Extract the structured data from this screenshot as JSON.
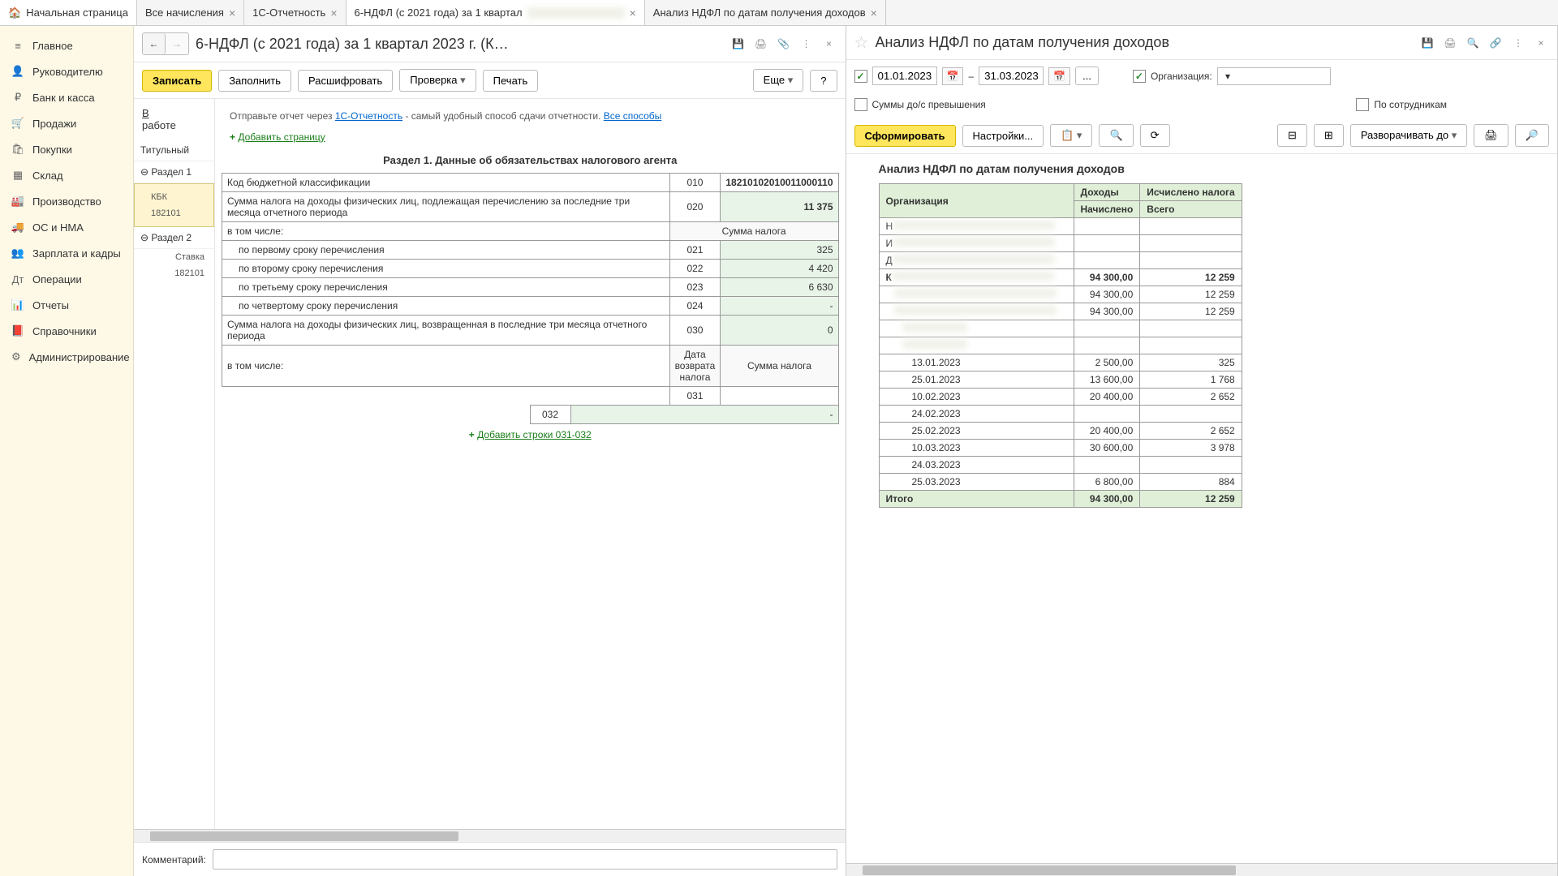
{
  "tabs": {
    "home": "Начальная страница",
    "t1": "Все начисления",
    "t2": "1С-Отчетность",
    "t3": "6-НДФЛ (с 2021 года) за 1 квартал",
    "t4": "Анализ НДФЛ по датам получения доходов"
  },
  "sidebar": [
    {
      "ico": "≡",
      "label": "Главное"
    },
    {
      "ico": "👤",
      "label": "Руководителю"
    },
    {
      "ico": "₽",
      "label": "Банк и касса"
    },
    {
      "ico": "🛒",
      "label": "Продажи"
    },
    {
      "ico": "🛍",
      "label": "Покупки"
    },
    {
      "ico": "▦",
      "label": "Склад"
    },
    {
      "ico": "🏭",
      "label": "Производство"
    },
    {
      "ico": "🚚",
      "label": "ОС и НМА"
    },
    {
      "ico": "👥",
      "label": "Зарплата и кадры"
    },
    {
      "ico": "Дт",
      "label": "Операции"
    },
    {
      "ico": "📊",
      "label": "Отчеты"
    },
    {
      "ico": "📕",
      "label": "Справочники"
    },
    {
      "ico": "⚙",
      "label": "Администрирование"
    }
  ],
  "left_panel": {
    "title": "6-НДФЛ (с 2021 года) за 1 квартал 2023 г. (К…",
    "btn_write": "Записать",
    "btn_fill": "Заполнить",
    "btn_decrypt": "Расшифровать",
    "btn_check": "Проверка",
    "btn_print": "Печать",
    "btn_more": "Еще",
    "status_line1": "В",
    "status_line2": "работе",
    "info_text1": "Отправьте отчет через ",
    "info_link1": "1С-Отчетность",
    "info_text2": " - самый удобный способ сдачи отчетности. ",
    "info_link2": "Все способы",
    "sections": {
      "title_tab": "Титульный",
      "sec1": "Раздел 1",
      "sec1_sub1": "КБК",
      "sec1_sub2": "182101",
      "sec2": "Раздел 2",
      "sec2_sub1": "Ставка",
      "sec2_sub2": "182101"
    },
    "add_page": "Добавить страницу",
    "section_header": "Раздел 1. Данные об обязательствах налогового агента",
    "rows": {
      "r1_label": "Код бюджетной классификации",
      "r1_code": "010",
      "r1_val": "18210102010011000110",
      "r2_label": "Сумма налога на доходы физических лиц, подлежащая перечислению за последние три месяца отчетного периода",
      "r2_code": "020",
      "r2_val": "11 375",
      "incl": "в том числе:",
      "sum_hdr": "Сумма налога",
      "r3_label": "по первому сроку перечисления",
      "r3_code": "021",
      "r3_val": "325",
      "r4_label": "по второму сроку перечисления",
      "r4_code": "022",
      "r4_val": "4 420",
      "r5_label": "по третьему сроку перечисления",
      "r5_code": "023",
      "r5_val": "6 630",
      "r6_label": "по четвертому сроку перечисления",
      "r6_code": "024",
      "r6_val": "-",
      "r7_label": "Сумма налога на доходы физических лиц, возвращенная в последние три месяца отчетного периода",
      "r7_code": "030",
      "r7_val": "0",
      "date_hdr": "Дата возврата налога",
      "r8_code1": "031",
      "r8_code2": "032",
      "r8_val": "-",
      "add_rows": "Добавить строки 031-032"
    },
    "comment_label": "Комментарий:"
  },
  "right_panel": {
    "title": "Анализ НДФЛ по датам получения доходов",
    "date_from": "01.01.2023",
    "date_to": "31.03.2023",
    "org_label": "Организация:",
    "chk_sums": "Суммы до/с превышения",
    "chk_emp": "По сотрудникам",
    "btn_form": "Сформировать",
    "btn_settings": "Настройки...",
    "btn_expand": "Разворачивать до",
    "report_title": "Анализ НДФЛ по датам получения доходов",
    "hdr_org": "Организация",
    "hdr_income": "Доходы",
    "hdr_tax": "Исчислено налога",
    "hdr_accrued": "Начислено",
    "hdr_total": "Всего",
    "row_prefix_n": "Н",
    "row_prefix_i": "И",
    "row_prefix_d": "Д",
    "row_prefix_k": "К",
    "total_label": "Итого",
    "data_rows": [
      {
        "d": "",
        "v1": "94 300,00",
        "v2": "12 259",
        "bold": true
      },
      {
        "d": "",
        "v1": "94 300,00",
        "v2": "12 259"
      },
      {
        "d": "",
        "v1": "94 300,00",
        "v2": "12 259"
      },
      {
        "d": "",
        "v1": "",
        "v2": ""
      },
      {
        "d": "",
        "v1": "",
        "v2": ""
      },
      {
        "d": "13.01.2023",
        "v1": "2 500,00",
        "v2": "325"
      },
      {
        "d": "25.01.2023",
        "v1": "13 600,00",
        "v2": "1 768"
      },
      {
        "d": "10.02.2023",
        "v1": "20 400,00",
        "v2": "2 652"
      },
      {
        "d": "24.02.2023",
        "v1": "",
        "v2": ""
      },
      {
        "d": "25.02.2023",
        "v1": "20 400,00",
        "v2": "2 652"
      },
      {
        "d": "10.03.2023",
        "v1": "30 600,00",
        "v2": "3 978"
      },
      {
        "d": "24.03.2023",
        "v1": "",
        "v2": ""
      },
      {
        "d": "25.03.2023",
        "v1": "6 800,00",
        "v2": "884"
      }
    ],
    "total_v1": "94 300,00",
    "total_v2": "12 259"
  }
}
